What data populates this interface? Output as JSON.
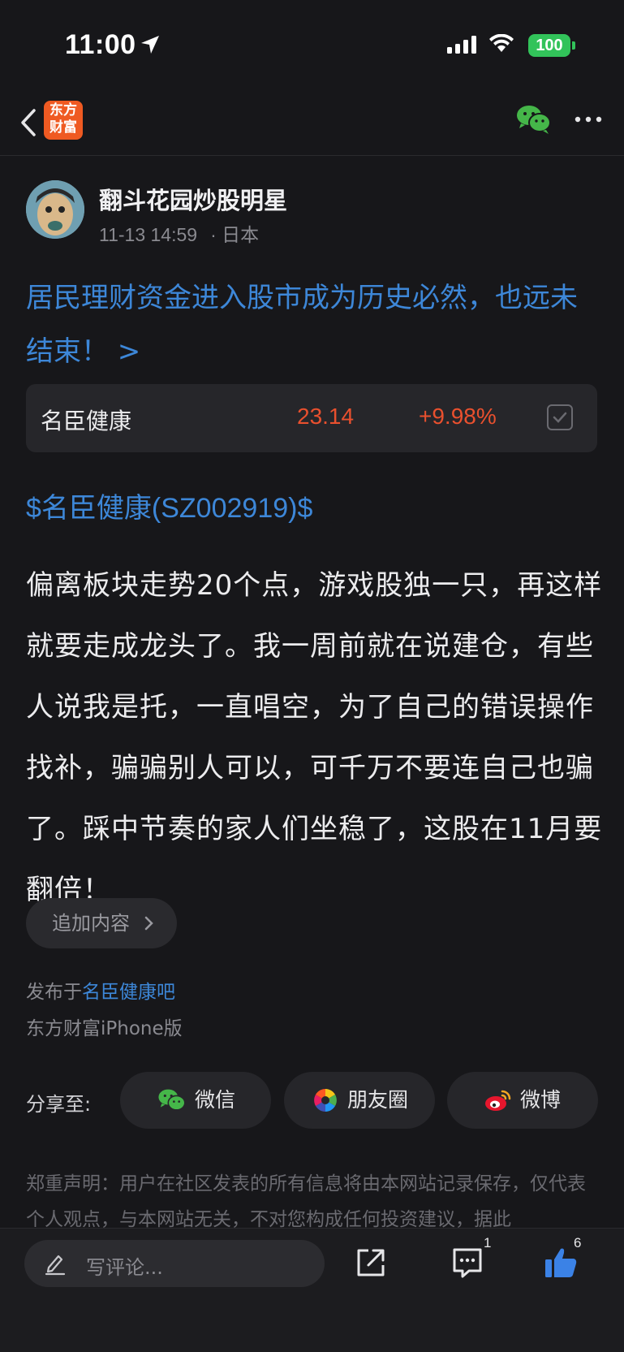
{
  "status_bar": {
    "time": "11:00",
    "battery": "100"
  },
  "nav": {
    "logo_line1": "东方",
    "logo_line2": "财富"
  },
  "author": {
    "name": "翻斗花园炒股明星",
    "timestamp": "11-13 14:59",
    "location": "· 日本"
  },
  "post": {
    "headline": "居民理财资金进入股市成为历史必然，也远未结束！ >",
    "stock_card": {
      "name": "名臣健康",
      "price": "23.14",
      "change": "+9.98%"
    },
    "stock_link": "$名臣健康(SZ002919)$",
    "body": "偏离板块走势20个点，游戏股独一只，再这样就要走成龙头了。我一周前就在说建仓，有些人说我是托，一直唱空，为了自己的错误操作找补，骗骗别人可以，可千万不要连自己也骗了。踩中节奏的家人们坐稳了，这股在11月要翻倍！",
    "add_content": "追加内容",
    "published_prefix": "发布于",
    "published_bar": "名臣健康吧",
    "client": "东方财富iPhone版"
  },
  "share": {
    "label": "分享至:",
    "wechat": "微信",
    "moments": "朋友圈",
    "weibo": "微博"
  },
  "disclaimer": "郑重声明：用户在社区发表的所有信息将由本网站记录保存，仅代表个人观点，与本网站无关，不对您构成任何投资建议，据此",
  "bottom_bar": {
    "comment_placeholder": "写评论...",
    "comment_count": "1",
    "like_count": "6"
  },
  "colors": {
    "accent_blue": "#3d87d8",
    "price_red": "#e9502e",
    "battery_green": "#32c35a",
    "brand_orange": "#ef5a22"
  },
  "icons": [
    "location-arrow-icon",
    "signal-icon",
    "wifi-icon",
    "back-chevron-icon",
    "wechat-icon",
    "more-icon",
    "checkbox-icon",
    "chevron-right-icon",
    "moments-icon",
    "weibo-icon",
    "pen-icon",
    "share-icon",
    "comment-icon",
    "thumbs-up-icon"
  ]
}
